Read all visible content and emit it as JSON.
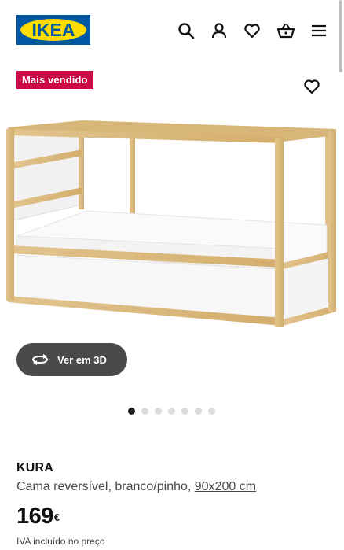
{
  "header": {
    "logo_text": "IKEA",
    "icons": [
      "search-icon",
      "user-icon",
      "heart-icon",
      "basket-icon",
      "menu-icon"
    ]
  },
  "badge": {
    "label": "Mais vendido",
    "color": "#cc0a47"
  },
  "viewer": {
    "button_label": "Ver em 3D"
  },
  "carousel": {
    "total": 7,
    "current": 1
  },
  "product": {
    "name": "KURA",
    "description": "Cama reversível, branco/pinho,",
    "size_link": "90x200 cm",
    "price": "169",
    "currency": "€",
    "vat_note": "IVA incluído no preço"
  },
  "colors": {
    "brand_blue": "#0058a3",
    "brand_yellow": "#ffdb00"
  }
}
